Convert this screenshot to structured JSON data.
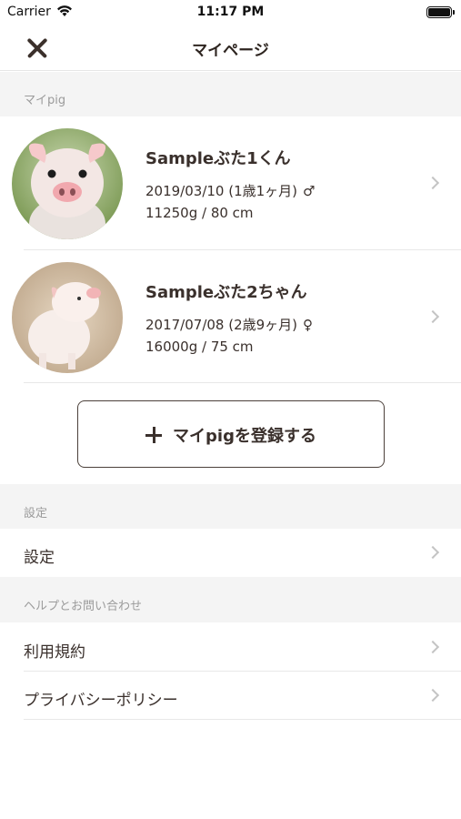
{
  "status_bar": {
    "carrier": "Carrier",
    "time": "11:17 PM"
  },
  "nav": {
    "title": "マイページ"
  },
  "sections": {
    "my_pig": "マイpig",
    "settings": "設定",
    "help": "ヘルプとお問い合わせ"
  },
  "pigs": [
    {
      "name": "Sampleぶた1くん",
      "birth": "2019/03/10 (1歳1ヶ月)",
      "gender": "♂",
      "weight": "11250g / 80 cm",
      "photo": "pig-photo-1"
    },
    {
      "name": "Sampleぶた2ちゃん",
      "birth": "2017/07/08 (2歳9ヶ月)",
      "gender": "♀",
      "weight": "16000g / 75 cm",
      "photo": "pig-photo-2"
    }
  ],
  "add_button": {
    "label": "マイpigを登録する"
  },
  "settings_items": [
    {
      "label": "設定"
    }
  ],
  "help_items": [
    {
      "label": "利用規約"
    },
    {
      "label": "プライバシーポリシー"
    }
  ],
  "colors": {
    "text": "#3a302c",
    "section_bg": "#f4f4f4",
    "section_text": "#9b9b9b",
    "chevron": "#c4c4c4"
  }
}
